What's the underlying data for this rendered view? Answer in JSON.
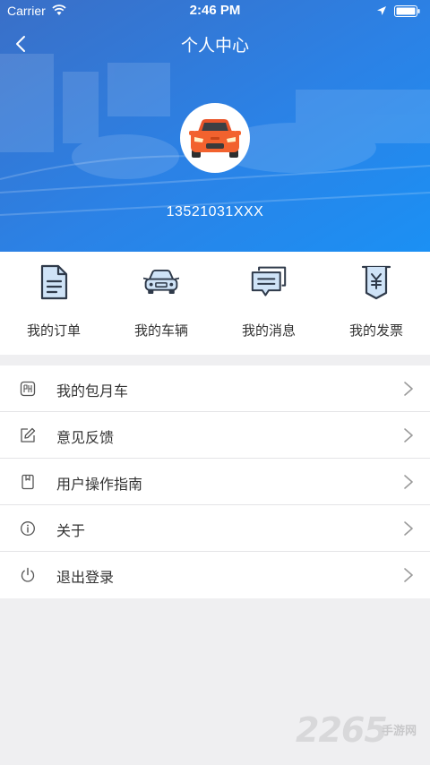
{
  "status_bar": {
    "carrier": "Carrier",
    "time": "2:46 PM",
    "icons": [
      "wifi-icon",
      "location-icon",
      "battery-icon"
    ]
  },
  "nav": {
    "title": "个人中心",
    "back_icon": "chevron-left-icon"
  },
  "profile": {
    "avatar_icon": "car-icon",
    "phone": "13521031XXX"
  },
  "quick_menu": [
    {
      "label": "我的订单",
      "icon": "document-icon"
    },
    {
      "label": "我的车辆",
      "icon": "car-front-icon"
    },
    {
      "label": "我的消息",
      "icon": "message-icon"
    },
    {
      "label": "我的发票",
      "icon": "invoice-icon"
    }
  ],
  "menu_list": [
    {
      "label": "我的包月车",
      "icon": "monthly-pass-icon"
    },
    {
      "label": "意见反馈",
      "icon": "edit-icon"
    },
    {
      "label": "用户操作指南",
      "icon": "guide-icon"
    },
    {
      "label": "关于",
      "icon": "info-icon"
    },
    {
      "label": "退出登录",
      "icon": "power-icon"
    }
  ],
  "watermark": {
    "number": "2265",
    "site": "手游网"
  },
  "colors": {
    "header_blue": "#2a86ea",
    "avatar_car": "#f2622e",
    "icon_fill": "#cfe3f7",
    "icon_stroke": "#2f3a4a",
    "background": "#efeff1"
  }
}
